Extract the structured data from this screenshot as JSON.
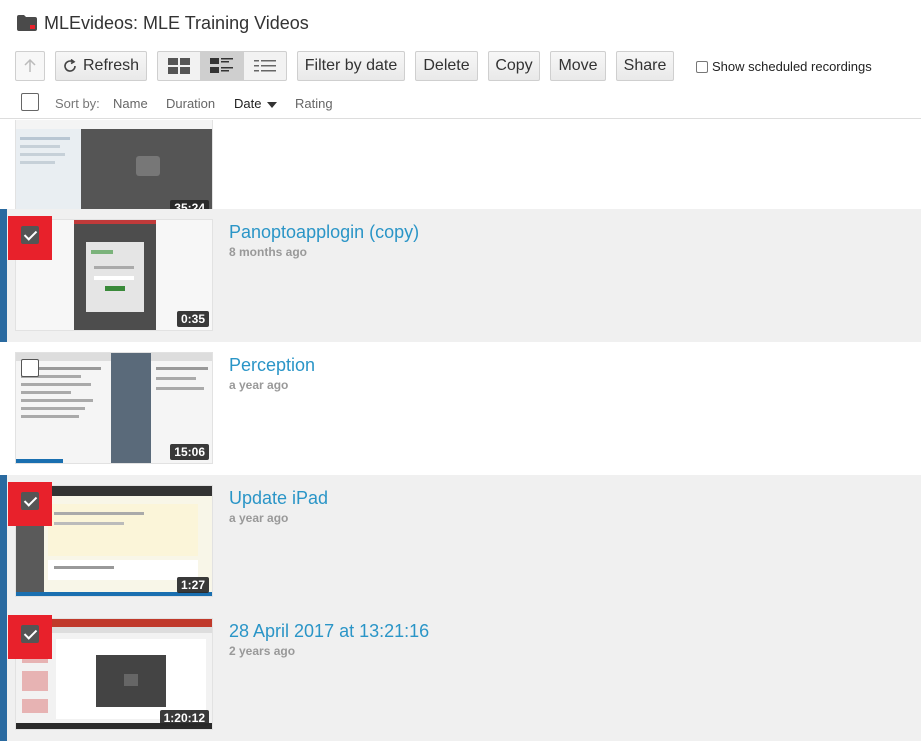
{
  "header": {
    "title": "MLEvideos: MLE Training Videos",
    "icon": "folder-icon"
  },
  "toolbar": {
    "refresh_label": "Refresh",
    "filter_label": "Filter by date",
    "delete_label": "Delete",
    "copy_label": "Copy",
    "move_label": "Move",
    "share_label": "Share",
    "scheduled_label": "Show scheduled recordings",
    "active_view": "detail"
  },
  "sortbar": {
    "label": "Sort by:",
    "options": [
      "Name",
      "Duration",
      "Date",
      "Rating"
    ],
    "active": "Date"
  },
  "colors": {
    "accent": "#2a95c7",
    "selection_bar": "#2a6aa0",
    "highlight": "#e8212b",
    "progress": "#1a6fb0"
  },
  "sessions": [
    {
      "title": "",
      "date": "",
      "duration": "35:24",
      "checked": false,
      "highlighted": false,
      "progress": 0
    },
    {
      "title": "Panoptoapplogin (copy)",
      "date": "8 months ago",
      "duration": "0:35",
      "checked": true,
      "highlighted": true,
      "progress": 0
    },
    {
      "title": "Perception",
      "date": "a year ago",
      "duration": "15:06",
      "checked": false,
      "highlighted": false,
      "progress": 0.24
    },
    {
      "title": "Update iPad",
      "date": "a year ago",
      "duration": "1:27",
      "checked": true,
      "highlighted": true,
      "progress": 1.0
    },
    {
      "title": "28 April 2017 at 13:21:16",
      "date": "2 years ago",
      "duration": "1:20:12",
      "checked": true,
      "highlighted": true,
      "progress": 0
    }
  ]
}
